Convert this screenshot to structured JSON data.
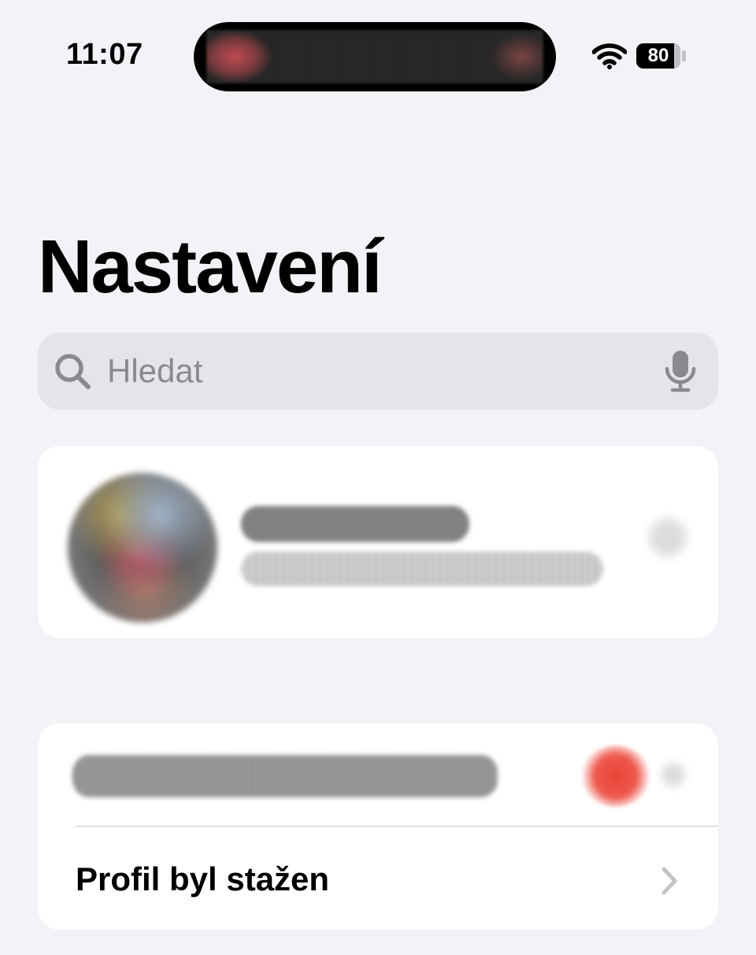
{
  "status_bar": {
    "time": "11:07",
    "battery_level": "80",
    "wifi_icon": "wifi-icon"
  },
  "header": {
    "title": "Nastavení"
  },
  "search": {
    "placeholder": "Hledat",
    "search_icon": "search-icon",
    "mic_icon": "microphone-icon"
  },
  "settings_list": {
    "rows": [
      {
        "label": "Profil byl stažen",
        "chevron_icon": "chevron-right-icon"
      }
    ]
  },
  "colors": {
    "background": "#f2f2f7",
    "card": "#ffffff",
    "search_field": "#e4e4ea",
    "placeholder": "#8a8a8e",
    "badge": "#ea4335",
    "chevron": "#c4c4c6"
  }
}
